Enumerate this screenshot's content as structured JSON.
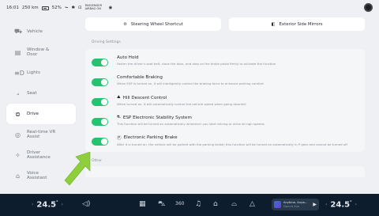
{
  "status": {
    "time": "16:01",
    "range": "250 km",
    "battery": "52%",
    "airbag_label": "PASSENGER AIRBAG ON"
  },
  "sidebar": {
    "items": [
      {
        "label": "Vehicle",
        "icon": "car-icon"
      },
      {
        "label": "Window & Door",
        "icon": "door-icon"
      },
      {
        "label": "Lights",
        "icon": "lights-icon"
      },
      {
        "label": "Seat",
        "icon": "seat-icon"
      },
      {
        "label": "Drive",
        "icon": "steering-wheel-icon",
        "active": true
      },
      {
        "label": "Real-time VR Assist",
        "icon": "vr-icon"
      },
      {
        "label": "Driver Assistance",
        "icon": "assist-icon"
      },
      {
        "label": "Voice Assistant",
        "icon": "voice-icon"
      }
    ]
  },
  "shortcuts": {
    "steering": "Steering Wheel Shortcut",
    "mirrors": "Exterior Side Mirrors"
  },
  "driving_settings": {
    "section_label": "Driving Settings",
    "items": [
      {
        "title": "Auto Hold",
        "desc": "Fasten the driver's seat belt, close the door, and step on the brake pedal firmly to activate the function",
        "enabled": true
      },
      {
        "title": "Comfortable Braking",
        "desc": "When ESP is turned on, it will intelligently control the braking force to enhance parking comfort",
        "enabled": true
      },
      {
        "title": "Hill Descent Control",
        "desc": "When turned on, it will automatically control the vehicle speed when going downhill",
        "enabled": true
      },
      {
        "title": "ESP Electronic Stability System",
        "desc": "This function will be turned on automatically whenever you start driving or drive at high speeds",
        "enabled": true
      },
      {
        "title": "Electronic Parking Brake",
        "desc": "After it is turned on, the vehicle will be parked with the parking brake; this function will be turned on automatically in P gear and cannot be turned off",
        "enabled": true
      }
    ]
  },
  "other": {
    "section_label": "Other"
  },
  "dock": {
    "left_temp": "24.5",
    "right_temp": "24.5",
    "degree": "°",
    "fan_speed": "360",
    "media_title": "Anytime, Anyw...",
    "media_sub": "Dennis Kuo"
  },
  "colors": {
    "toggle_on": "#25c26f",
    "dock_bg": "#0d1d2d",
    "arrow": "#8fcf3c"
  }
}
